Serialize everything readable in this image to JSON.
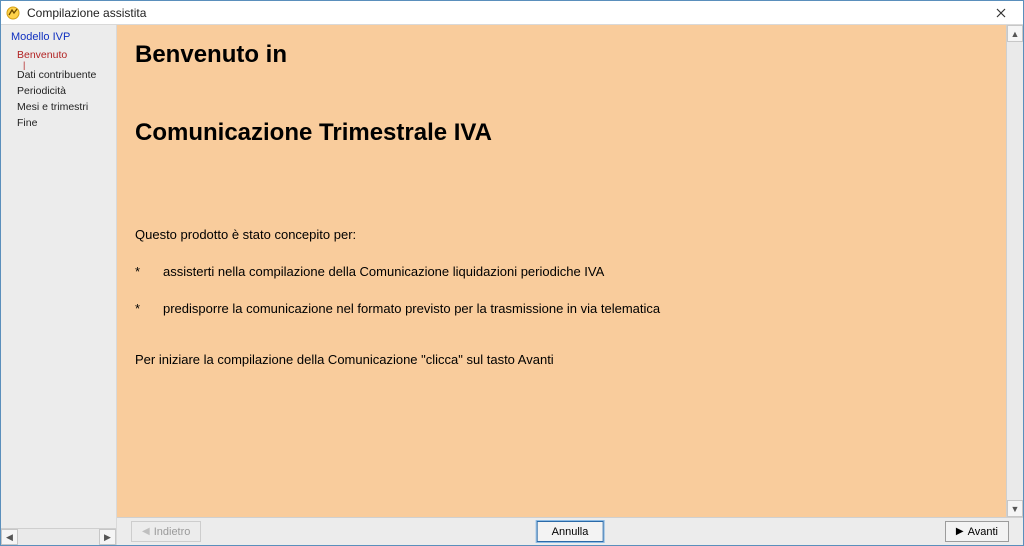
{
  "window": {
    "title": "Compilazione assistita"
  },
  "sidebar": {
    "header": "Modello IVP",
    "items": [
      {
        "label": "Benvenuto",
        "selected": true
      },
      {
        "label": "Dati contribuente",
        "selected": false
      },
      {
        "label": "Periodicità",
        "selected": false
      },
      {
        "label": "Mesi e trimestri",
        "selected": false
      },
      {
        "label": "Fine",
        "selected": false
      }
    ]
  },
  "content": {
    "heading1": "Benvenuto in",
    "heading2": "Comunicazione Trimestrale IVA",
    "intro": "Questo prodotto è stato concepito per:",
    "bullet1": "assisterti nella compilazione della Comunicazione liquidazioni periodiche IVA",
    "bullet2": "predisporre la comunicazione nel formato previsto per la trasmissione in via telematica",
    "final": "Per iniziare la compilazione della Comunicazione \"clicca\" sul tasto Avanti"
  },
  "footer": {
    "back": "Indietro",
    "cancel": "Annulla",
    "next": "Avanti"
  }
}
